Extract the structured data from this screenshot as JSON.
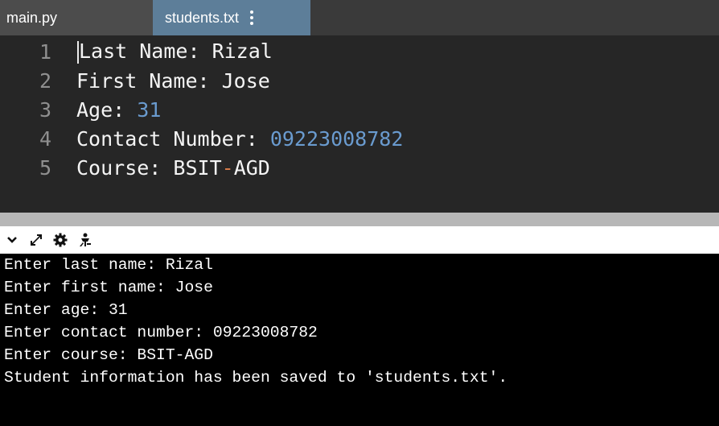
{
  "tabs": [
    {
      "label": "main.py",
      "active": false
    },
    {
      "label": "students.txt",
      "active": true
    }
  ],
  "editor": {
    "lines": [
      {
        "number": "1",
        "text": "Last Name: Rizal"
      },
      {
        "number": "2",
        "text": "First Name: Jose"
      },
      {
        "number": "3",
        "text": "Age: ",
        "num": "31"
      },
      {
        "number": "4",
        "text": "Contact Number: ",
        "num": "09223008782"
      },
      {
        "number": "5",
        "text": "Course: BSIT",
        "dash": "-",
        "text2": "AGD"
      }
    ]
  },
  "toolbar": {
    "icons": [
      "chevron-down-icon",
      "expand-icon",
      "gear-icon",
      "clear-console-icon"
    ]
  },
  "console": {
    "lines": [
      "Enter last name: Rizal",
      "Enter first name: Jose",
      "Enter age: 31",
      "Enter contact number: 09223008782",
      "Enter course: BSIT-AGD",
      "Student information has been saved to 'students.txt'."
    ]
  },
  "colors": {
    "active_tab": "#5d7e99",
    "editor_bg": "#262626",
    "number_literal": "#6a9bcf",
    "operator": "#d57a48"
  }
}
